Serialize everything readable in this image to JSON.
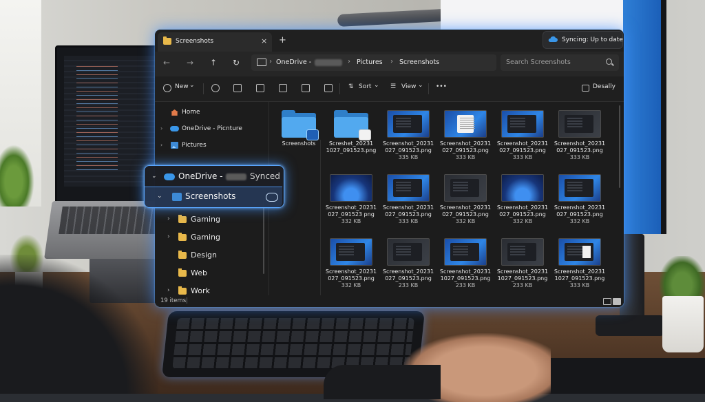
{
  "window": {
    "tab_title": "Screenshots",
    "tab_close": "×",
    "new_tab": "+",
    "sync_status": "Syncing: Up to date"
  },
  "nav": {
    "back": "←",
    "forward": "→",
    "up": "↑",
    "refresh": "↻",
    "breadcrumb": [
      "OneDrive -",
      "Pictures",
      "Screenshots"
    ],
    "separator": "›",
    "search_placeholder": "Search Screenshots"
  },
  "toolbar": {
    "new_label": "New",
    "sort_label": "Sort",
    "view_label": "View",
    "more_label": "•••",
    "details_label": "Desally",
    "dropdown": "⌄"
  },
  "sidebar": {
    "home": "Home",
    "onedrive": "OneDrive - Picnture",
    "pictures": "Pictures",
    "chevron": "›",
    "folders": [
      "Gaming",
      "Gaming",
      "Design",
      "Web",
      "Work"
    ]
  },
  "callout": {
    "onedrive_label": "OneDrive -",
    "synced": "Synced",
    "screenshots": "Screenshots"
  },
  "files": [
    {
      "name": "Screenshots",
      "size": "",
      "kind": "folder"
    },
    {
      "name": "Screshet_20231\n1027_091523.png",
      "size": "",
      "kind": "folder-cloud"
    },
    {
      "name": "Screenshot_20231\n027_091523.png",
      "size": "335 KB",
      "kind": "blue"
    },
    {
      "name": "Screenshot_20231\n027_091523.png",
      "size": "333 KB",
      "kind": "doc"
    },
    {
      "name": "Screenshot_20231\n027_091523.png",
      "size": "333 KB",
      "kind": "blue"
    },
    {
      "name": "Screenshot_20231\n027_091523.png",
      "size": "333 KB",
      "kind": "dark"
    },
    {
      "name": "Screenshot_20231\n027_091523 png",
      "size": "332 KB",
      "kind": "swirl"
    },
    {
      "name": "Screenshot_20231\n027_091523.png",
      "size": "333 KB",
      "kind": "blue"
    },
    {
      "name": "Screenshot_20231\n027_091523.png",
      "size": "332 KB",
      "kind": "dark"
    },
    {
      "name": "Screenshot_20231\n027_091523.png",
      "size": "332 KB",
      "kind": "swirl"
    },
    {
      "name": "Screenshot_20231\n027_091523.png",
      "size": "332 KB",
      "kind": "blue"
    },
    {
      "name": "Screenshot_20231\n027_091523.png",
      "size": "332 KB",
      "kind": "blue"
    },
    {
      "name": "Screenshot_20231\n027_091523.png",
      "size": "233 KB",
      "kind": "dark"
    },
    {
      "name": "Screenshot_20231\n1027_091523.png",
      "size": "233 KB",
      "kind": "blue"
    },
    {
      "name": "Screenshot_20231\n1027_091523.png",
      "size": "233 KB",
      "kind": "dark"
    },
    {
      "name": "Screenshot_20231\n1027_091523.png",
      "size": "333 KB",
      "kind": "white"
    }
  ],
  "status": {
    "items": "19 items",
    "sep": "|"
  },
  "colors": {
    "accent": "#3a96e8",
    "glow": "#5aa6ff",
    "window_bg": "#1c1c1c",
    "folder": "#e8b84a"
  }
}
